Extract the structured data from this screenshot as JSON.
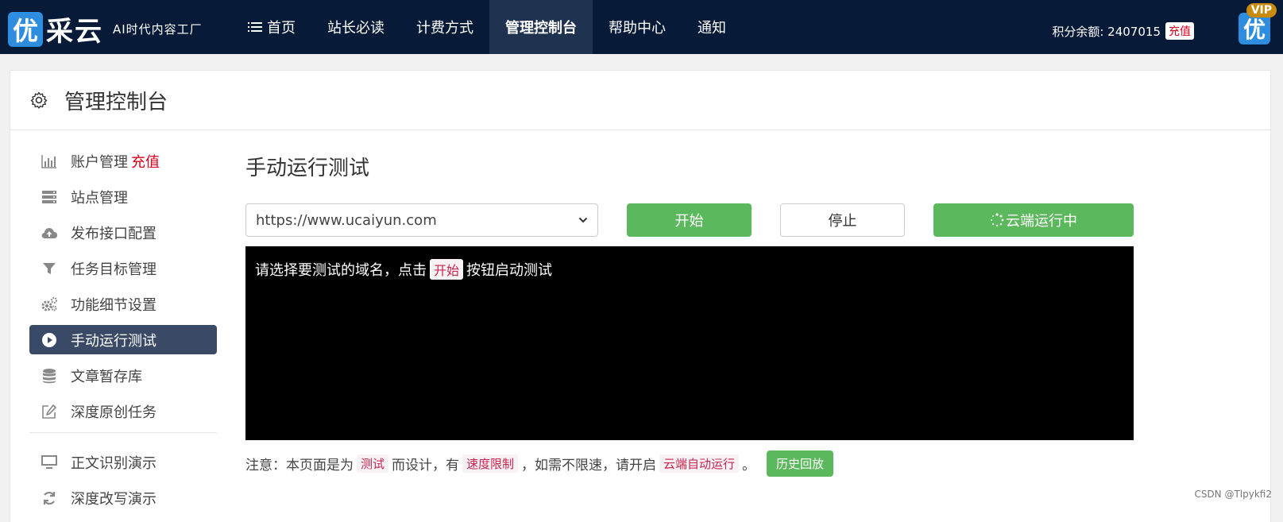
{
  "header": {
    "logo_badge": "优",
    "logo_text": "采云",
    "slogan": "AI时代内容工厂",
    "nav": [
      {
        "label": "首页"
      },
      {
        "label": "站长必读"
      },
      {
        "label": "计费方式"
      },
      {
        "label": "管理控制台"
      },
      {
        "label": "帮助中心"
      },
      {
        "label": "通知"
      }
    ],
    "balance_label": "积分余额: 2407015",
    "recharge_label": "充值",
    "avatar_text": "优",
    "vip_label": "VIP"
  },
  "panel": {
    "title": "管理控制台"
  },
  "sidebar": {
    "items": [
      {
        "label": "账户管理",
        "extra": "充值"
      },
      {
        "label": "站点管理"
      },
      {
        "label": "发布接口配置"
      },
      {
        "label": "任务目标管理"
      },
      {
        "label": "功能细节设置"
      },
      {
        "label": "手动运行测试"
      },
      {
        "label": "文章暂存库"
      },
      {
        "label": "深度原创任务"
      },
      {
        "label": "正文识别演示"
      },
      {
        "label": "深度改写演示"
      }
    ]
  },
  "main": {
    "title": "手动运行测试",
    "domain_value": "https://www.ucaiyun.com",
    "start_label": "开始",
    "stop_label": "停止",
    "cloud_label": "云端运行中",
    "console": {
      "prefix": "请选择要测试的域名，点击",
      "tag": "开始",
      "suffix": "按钮启动测试"
    },
    "note": {
      "p1": "注意：本页面是为",
      "t1": "测试",
      "p2": "而设计，有",
      "t2": "速度限制",
      "p3": "，如需不限速，请开启",
      "t3": "云端自动运行",
      "p4": "。",
      "history_label": "历史回放"
    }
  },
  "watermark": "CSDN @Tlpykfi2",
  "colors": {
    "nav_bg": "#071a37",
    "nav_active": "#1f3350",
    "sidebar_active": "#3a4a66",
    "green": "#5cb85c",
    "red": "#d9001b"
  }
}
